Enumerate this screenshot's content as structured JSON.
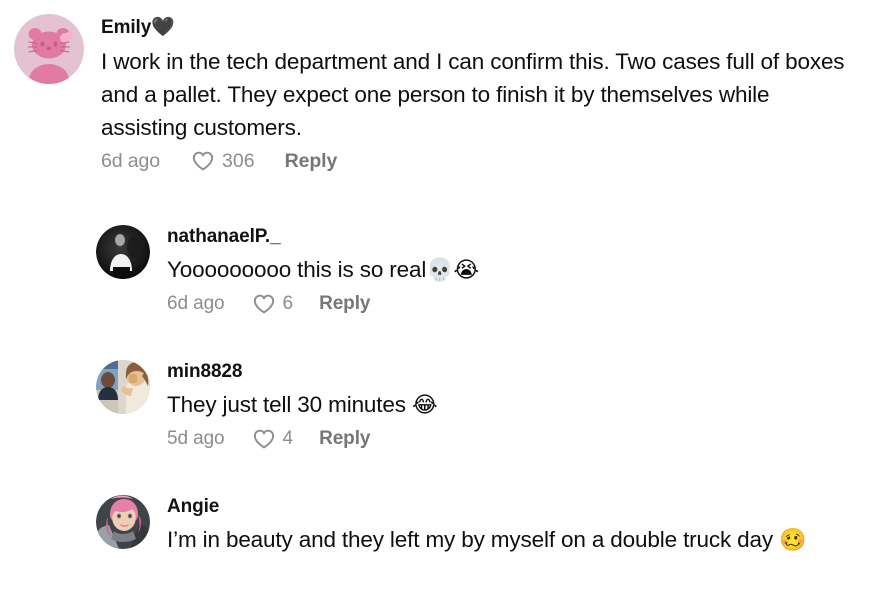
{
  "colors": {
    "background": "#ffffff",
    "text": "#0f0f0f",
    "username": "#121212",
    "meta_gray": "#8d8d8d",
    "reply_gray": "#767676",
    "avatar_pink_bg": "#e8c4d4",
    "avatar_pink_fg": "#e8789f"
  },
  "comments": [
    {
      "id": "emily",
      "username": "Emily",
      "username_emoji": "🖤",
      "avatar": "hello-kitty-avatar",
      "text": "I work in the tech department and I can confirm this. Two cases full of boxes and a pallet. They expect one person to finish it by themselves while assisting customers.",
      "time": "6d ago",
      "likes": "306",
      "reply_label": "Reply",
      "heart_icon": "heart-outline-icon"
    },
    {
      "id": "nathanael",
      "username": "nathanaelP._",
      "username_emoji": "",
      "avatar": "dark-photo-avatar",
      "text": "Yooooooooo this is so real",
      "text_emoji": "💀😭",
      "time": "6d ago",
      "likes": "6",
      "reply_label": "Reply",
      "heart_icon": "heart-outline-icon"
    },
    {
      "id": "min8828",
      "username": "min8828",
      "username_emoji": "",
      "avatar": "woman-drinking-avatar",
      "text": "They just tell 30 minutes ",
      "text_emoji": "😂",
      "time": "5d ago",
      "likes": "4",
      "reply_label": "Reply",
      "heart_icon": "heart-outline-icon"
    },
    {
      "id": "angie",
      "username": "Angie",
      "username_emoji": "",
      "avatar": "pink-hair-avatar",
      "text": "I’m in beauty and they left my by myself on a double truck day ",
      "text_emoji": "🥴",
      "time": "",
      "likes": "",
      "reply_label": ""
    }
  ]
}
